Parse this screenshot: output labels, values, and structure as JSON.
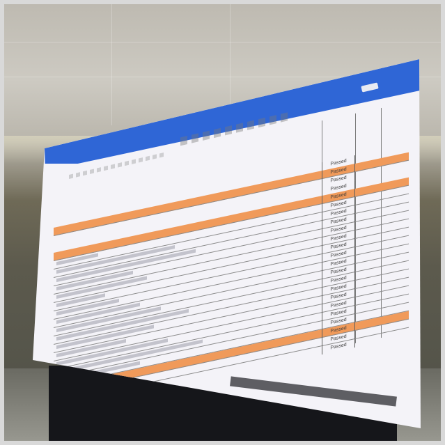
{
  "window": {
    "title_text": "",
    "top_right_button": ""
  },
  "ribbon": {
    "side_items": [
      "",
      "",
      "",
      ""
    ]
  },
  "sheet": {
    "header_status": "Passed",
    "status_values": [
      "Passed",
      "Passed",
      "Passed",
      "Passed",
      "Passed",
      "Passed",
      "Passed",
      "Passed",
      "Passed",
      "Passed",
      "Passed",
      "Passed",
      "Passed",
      "Passed",
      "Passed",
      "Passed",
      "Passed",
      "Passed",
      "Passed",
      "Passed",
      "Passed",
      "Passed",
      "Passed",
      "Passed"
    ]
  }
}
